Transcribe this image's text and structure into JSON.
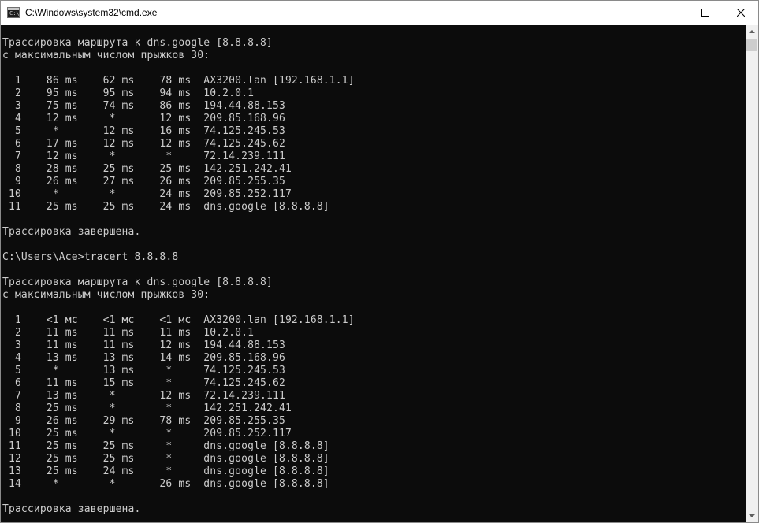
{
  "window": {
    "title": "C:\\Windows\\system32\\cmd.exe",
    "minimize": "minimize-icon",
    "maximize": "maximize-icon",
    "close": "close-icon"
  },
  "console": {
    "lines": [
      "Трассировка маршрута к dns.google [8.8.8.8]",
      "с максимальным числом прыжков 30:",
      "",
      "  1    86 ms    62 ms    78 ms  AX3200.lan [192.168.1.1]",
      "  2    95 ms    95 ms    94 ms  10.2.0.1",
      "  3    75 ms    74 ms    86 ms  194.44.88.153",
      "  4    12 ms     *       12 ms  209.85.168.96",
      "  5     *       12 ms    16 ms  74.125.245.53",
      "  6    17 ms    12 ms    12 ms  74.125.245.62",
      "  7    12 ms     *        *     72.14.239.111",
      "  8    28 ms    25 ms    25 ms  142.251.242.41",
      "  9    26 ms    27 ms    26 ms  209.85.255.35",
      " 10     *        *       24 ms  209.85.252.117",
      " 11    25 ms    25 ms    24 ms  dns.google [8.8.8.8]",
      "",
      "Трассировка завершена.",
      "",
      "C:\\Users\\Ace>tracert 8.8.8.8",
      "",
      "Трассировка маршрута к dns.google [8.8.8.8]",
      "с максимальным числом прыжков 30:",
      "",
      "  1    <1 мс    <1 мс    <1 мс  AX3200.lan [192.168.1.1]",
      "  2    11 ms    11 ms    11 ms  10.2.0.1",
      "  3    11 ms    11 ms    12 ms  194.44.88.153",
      "  4    13 ms    13 ms    14 ms  209.85.168.96",
      "  5     *       13 ms     *     74.125.245.53",
      "  6    11 ms    15 ms     *     74.125.245.62",
      "  7    13 ms     *       12 ms  72.14.239.111",
      "  8    25 ms     *        *     142.251.242.41",
      "  9    26 ms    29 ms    78 ms  209.85.255.35",
      " 10    25 ms     *        *     209.85.252.117",
      " 11    25 ms    25 ms     *     dns.google [8.8.8.8]",
      " 12    25 ms    25 ms     *     dns.google [8.8.8.8]",
      " 13    25 ms    24 ms     *     dns.google [8.8.8.8]",
      " 14     *        *       26 ms  dns.google [8.8.8.8]",
      "",
      "Трассировка завершена."
    ]
  },
  "colors": {
    "console_bg": "#0c0c0c",
    "console_text": "#cccccc",
    "titlebar_bg": "#ffffff"
  }
}
